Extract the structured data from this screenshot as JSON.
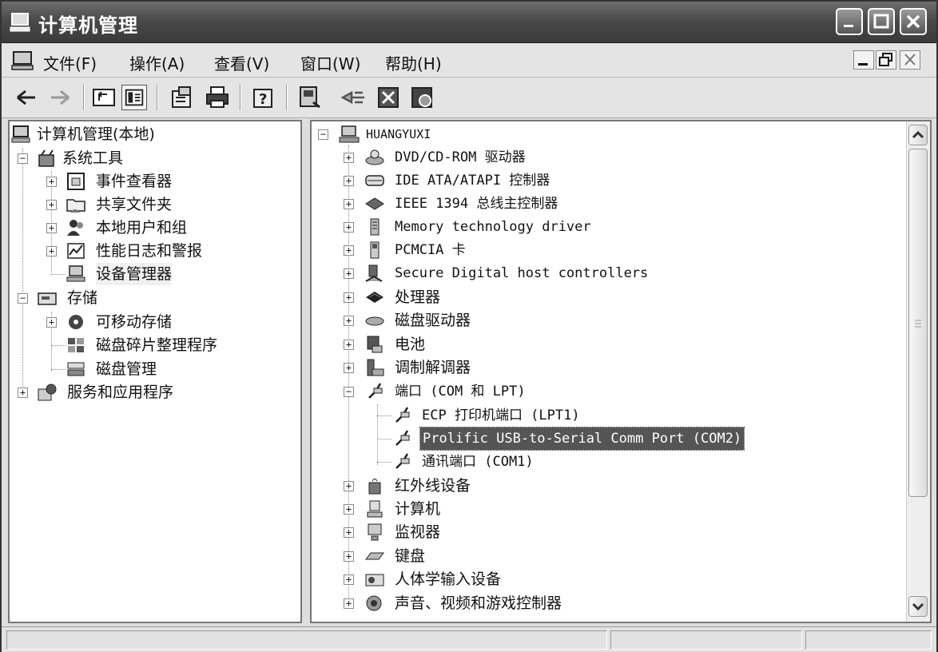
{
  "window": {
    "title": "计算机管理"
  },
  "menu": {
    "items": [
      "文件(F)",
      "操作(A)",
      "查看(V)",
      "窗口(W)",
      "帮助(H)"
    ]
  },
  "left_tree": [
    {
      "label": "计算机管理(本地)",
      "icon": "computer-icon"
    },
    {
      "label": "系统工具",
      "icon": "tools-icon"
    },
    {
      "label": "事件查看器",
      "icon": "event-viewer-icon"
    },
    {
      "label": "共享文件夹",
      "icon": "shared-folder-icon"
    },
    {
      "label": "本地用户和组",
      "icon": "users-icon"
    },
    {
      "label": "性能日志和警报",
      "icon": "performance-icon"
    },
    {
      "label": "设备管理器",
      "icon": "device-manager-icon"
    },
    {
      "label": "存储",
      "icon": "storage-icon"
    },
    {
      "label": "可移动存储",
      "icon": "removable-storage-icon"
    },
    {
      "label": "磁盘碎片整理程序",
      "icon": "defrag-icon"
    },
    {
      "label": "磁盘管理",
      "icon": "disk-management-icon"
    },
    {
      "label": "服务和应用程序",
      "icon": "services-icon"
    }
  ],
  "right_tree": [
    {
      "label": "HUANGYUXI",
      "icon": "computer-icon"
    },
    {
      "label": "DVD/CD-ROM 驱动器",
      "icon": "cdrom-icon"
    },
    {
      "label": "IDE ATA/ATAPI 控制器",
      "icon": "ide-controller-icon"
    },
    {
      "label": "IEEE 1394 总线主控制器",
      "icon": "ieee1394-icon"
    },
    {
      "label": "Memory technology driver",
      "icon": "memory-icon"
    },
    {
      "label": "PCMCIA 卡",
      "icon": "pcmcia-icon"
    },
    {
      "label": "Secure Digital host controllers",
      "icon": "sd-controller-icon"
    },
    {
      "label": "处理器",
      "icon": "processor-icon"
    },
    {
      "label": "磁盘驱动器",
      "icon": "disk-drive-icon"
    },
    {
      "label": "电池",
      "icon": "battery-icon"
    },
    {
      "label": "调制解调器",
      "icon": "modem-icon"
    },
    {
      "label": "端口 (COM 和 LPT)",
      "icon": "port-icon"
    },
    {
      "label": "ECP 打印机端口 (LPT1)",
      "icon": "port-icon"
    },
    {
      "label": "Prolific USB-to-Serial Comm Port (COM2)",
      "icon": "port-icon"
    },
    {
      "label": "通讯端口 (COM1)",
      "icon": "port-icon"
    },
    {
      "label": "红外线设备",
      "icon": "infrared-icon"
    },
    {
      "label": "计算机",
      "icon": "computer-icon"
    },
    {
      "label": "监视器",
      "icon": "monitor-icon"
    },
    {
      "label": "键盘",
      "icon": "keyboard-icon"
    },
    {
      "label": "人体学输入设备",
      "icon": "hid-icon"
    },
    {
      "label": "声音、视频和游戏控制器",
      "icon": "sound-icon"
    }
  ]
}
